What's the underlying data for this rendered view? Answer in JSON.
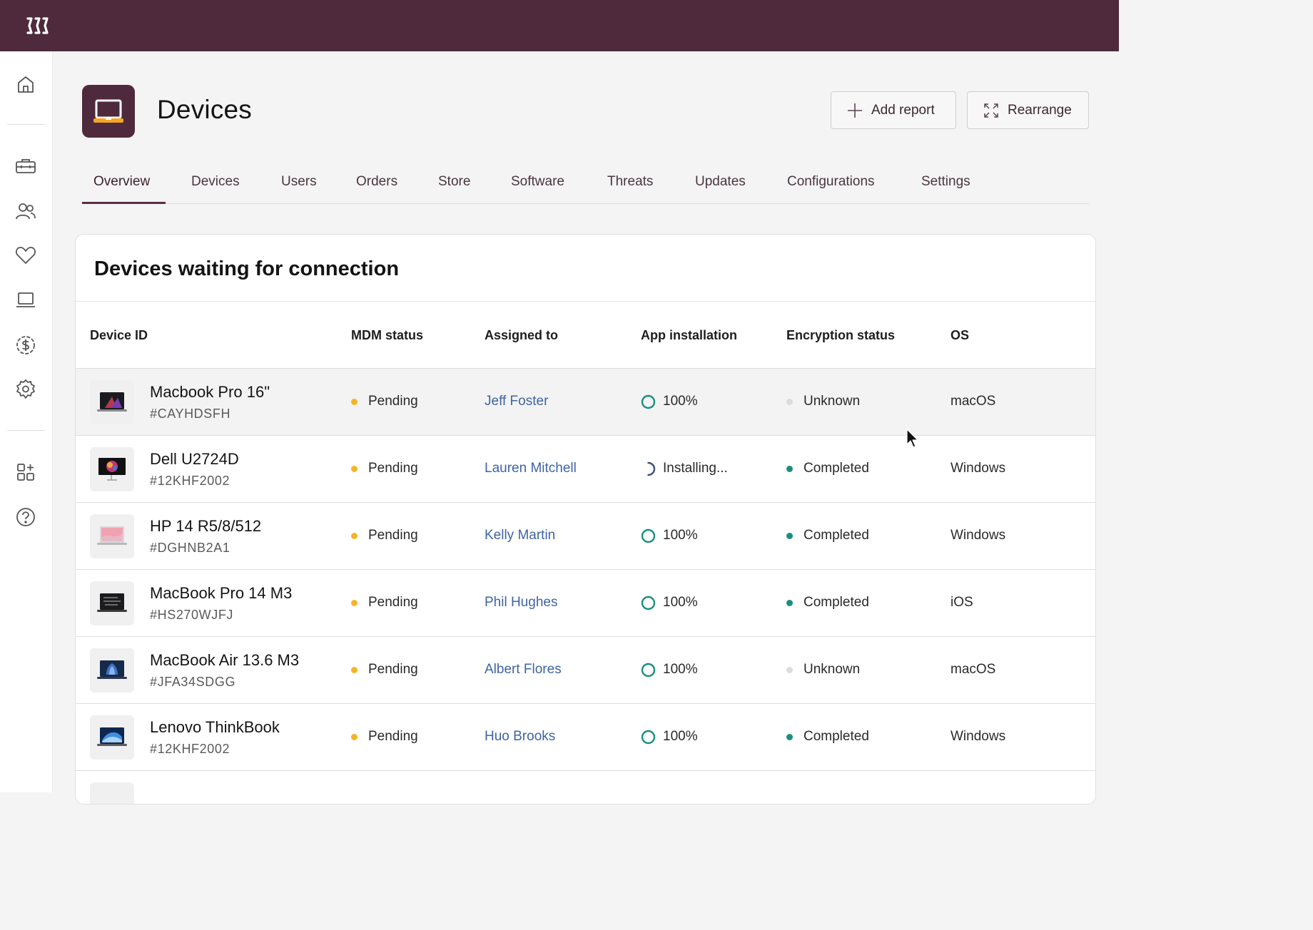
{
  "page": {
    "title": "Devices",
    "icon": "laptop-icon",
    "actions": {
      "add_report": "Add report",
      "rearrange": "Rearrange"
    }
  },
  "sidebar": {
    "items": [
      {
        "icon": "home-icon"
      },
      {
        "icon": "toolbox-icon"
      },
      {
        "icon": "users-icon"
      },
      {
        "icon": "heart-icon"
      },
      {
        "icon": "laptop-icon"
      },
      {
        "icon": "dollar-icon"
      },
      {
        "icon": "gear-icon"
      },
      {
        "icon": "add-app-icon"
      },
      {
        "icon": "help-icon"
      }
    ]
  },
  "tabs": [
    {
      "label": "Overview",
      "active": true
    },
    {
      "label": "Devices"
    },
    {
      "label": "Users"
    },
    {
      "label": "Orders"
    },
    {
      "label": "Store"
    },
    {
      "label": "Software"
    },
    {
      "label": "Threats"
    },
    {
      "label": "Updates"
    },
    {
      "label": "Configurations"
    },
    {
      "label": "Settings"
    }
  ],
  "table": {
    "title": "Devices waiting for connection",
    "columns": [
      "Device ID",
      "MDM status",
      "Assigned to",
      "App installation",
      "Encryption status",
      "OS"
    ],
    "rows": [
      {
        "name": "Macbook Pro 16\"",
        "id": "#CAYHDSFH",
        "mdm": "Pending",
        "assigned": "Jeff Foster",
        "app": "100%",
        "app_state": "done",
        "enc": "Unknown",
        "enc_state": "unknown",
        "os": "macOS"
      },
      {
        "name": "Dell U2724D",
        "id": "#12KHF2002",
        "mdm": "Pending",
        "assigned": "Lauren Mitchell",
        "app": "Installing...",
        "app_state": "installing",
        "enc": "Completed",
        "enc_state": "completed",
        "os": "Windows"
      },
      {
        "name": "HP 14 R5/8/512",
        "id": "#DGHNB2A1",
        "mdm": "Pending",
        "assigned": "Kelly Martin",
        "app": "100%",
        "app_state": "done",
        "enc": "Completed",
        "enc_state": "completed",
        "os": "Windows"
      },
      {
        "name": "MacBook Pro 14 M3",
        "id": "#HS270WJFJ",
        "mdm": "Pending",
        "assigned": "Phil Hughes",
        "app": "100%",
        "app_state": "done",
        "enc": "Completed",
        "enc_state": "completed",
        "os": "iOS"
      },
      {
        "name": "MacBook Air 13.6 M3",
        "id": "#JFA34SDGG",
        "mdm": "Pending",
        "assigned": "Albert Flores",
        "app": "100%",
        "app_state": "done",
        "enc": "Unknown",
        "enc_state": "unknown",
        "os": "macOS"
      },
      {
        "name": "Lenovo ThinkBook",
        "id": "#12KHF2002",
        "mdm": "Pending",
        "assigned": "Huo Brooks",
        "app": "100%",
        "app_state": "done",
        "enc": "Completed",
        "enc_state": "completed",
        "os": "Windows"
      }
    ]
  },
  "colors": {
    "brand": "#4e2a3c",
    "pending": "#f3b528",
    "completed": "#1a8f80",
    "unknown": "#dcdcdc",
    "link": "#3f64a0",
    "progress_ring": "#1a8f80"
  }
}
